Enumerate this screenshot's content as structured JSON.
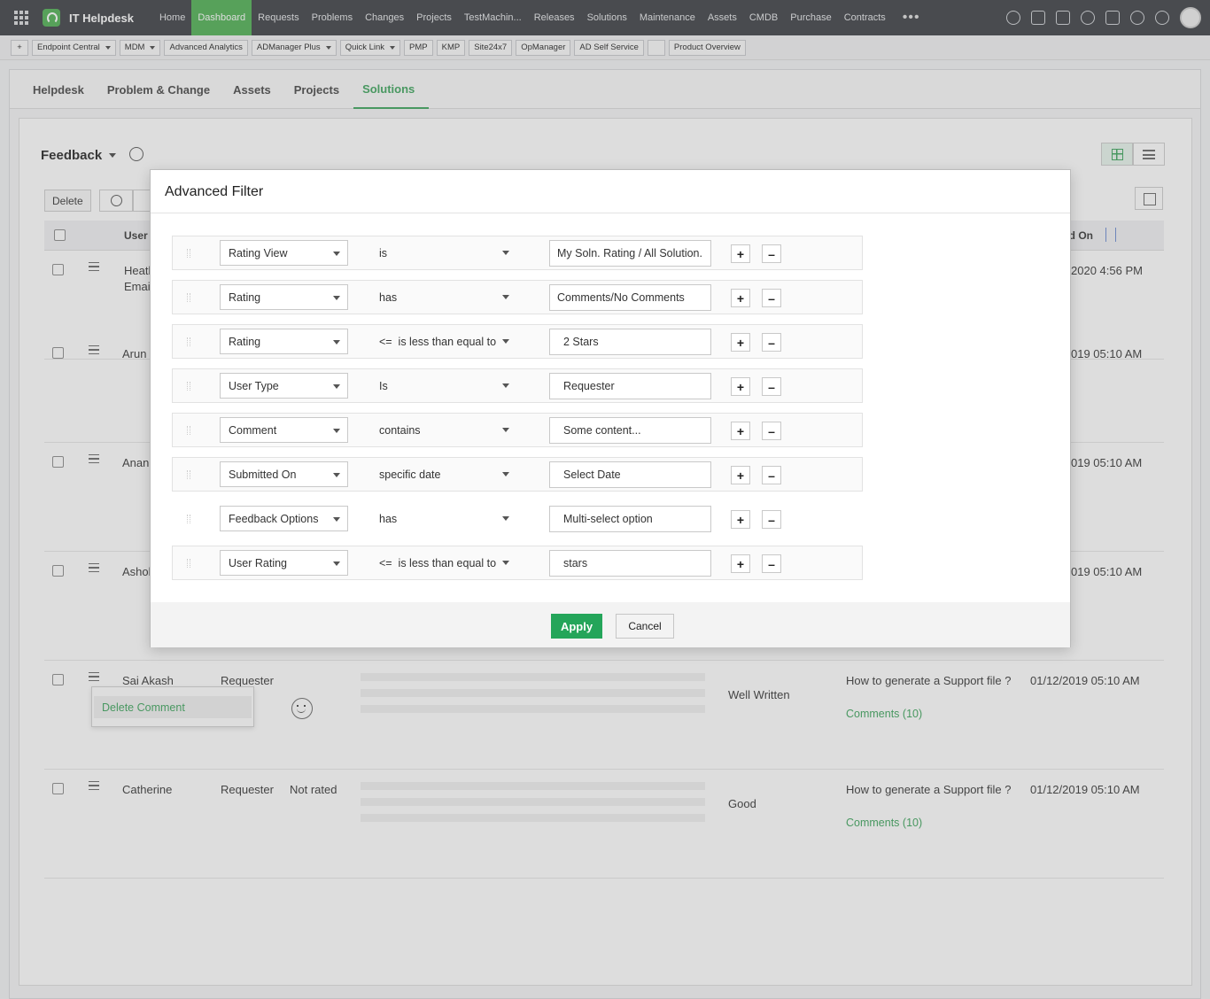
{
  "topnav": {
    "app_title": "IT Helpdesk",
    "links": [
      "Home",
      "Dashboard",
      "Requests",
      "Problems",
      "Changes",
      "Projects",
      "TestMachin...",
      "Releases",
      "Solutions",
      "Maintenance",
      "Assets",
      "CMDB",
      "Purchase",
      "Contracts"
    ],
    "active_link": "Dashboard",
    "more": "•••",
    "icons": [
      "search-icon",
      "sparkle-icon",
      "lightning-icon",
      "history-icon",
      "bell-icon",
      "gear-icon",
      "help-icon",
      "avatar"
    ]
  },
  "quickbar": {
    "items": [
      "Endpoint Central",
      "MDM",
      "Advanced Analytics",
      "ADManager Plus",
      "Quick Link",
      "PMP",
      "KMP",
      "Site24x7",
      "OpManager",
      "AD Self Service",
      "Product Overview"
    ]
  },
  "tabs": [
    "Helpdesk",
    "Problem & Change",
    "Assets",
    "Projects",
    "Solutions"
  ],
  "active_tab": "Solutions",
  "page": {
    "title": "Feedback",
    "delete_label": "Delete",
    "col_user": "User",
    "col_date": "ed On"
  },
  "rows": [
    {
      "name": "Heatl",
      "email": "Emai",
      "date": "2020 4:56 PM"
    },
    {
      "name": "Arun",
      "date": "019 05:10 AM"
    },
    {
      "name": "Anan",
      "date": "019 05:10 AM"
    },
    {
      "name": "Ashol",
      "date": "019 05:10 AM"
    },
    {
      "name": "Sai Akash",
      "type": "Requester",
      "feedback": "Well Written",
      "solution": "How to generate a Support file ?",
      "comments": "Comments (10)",
      "date": "01/12/2019 05:10 AM"
    },
    {
      "name": "Catherine",
      "type": "Requester",
      "rating": "Not rated",
      "feedback": "Good",
      "solution": "How to generate a Support file ?",
      "comments": "Comments (10)",
      "date": "01/12/2019 05:10 AM"
    }
  ],
  "context_menu": {
    "item": "Delete Comment"
  },
  "dialog": {
    "title": "Advanced Filter",
    "filters": [
      {
        "field": "Rating View",
        "op": "is",
        "value": "My Soln. Rating / All Solution."
      },
      {
        "field": "Rating",
        "op": "has",
        "value": "Comments/No Comments"
      },
      {
        "field": "Rating",
        "op": "<=  is less than equal to",
        "value": "2 Stars"
      },
      {
        "field": "User Type",
        "op": "Is",
        "value": "Requester"
      },
      {
        "field": "Comment",
        "op": "contains",
        "value": "Some content..."
      },
      {
        "field": "Submitted On",
        "op": "specific date",
        "value": "Select Date"
      },
      {
        "field": "Feedback Options",
        "op": "has",
        "value": "Multi-select option"
      },
      {
        "field": "User Rating",
        "op": "<=  is less than equal to",
        "value": "stars"
      }
    ],
    "plus": "+",
    "minus": "–",
    "apply_label": "Apply",
    "cancel_label": "Cancel"
  }
}
